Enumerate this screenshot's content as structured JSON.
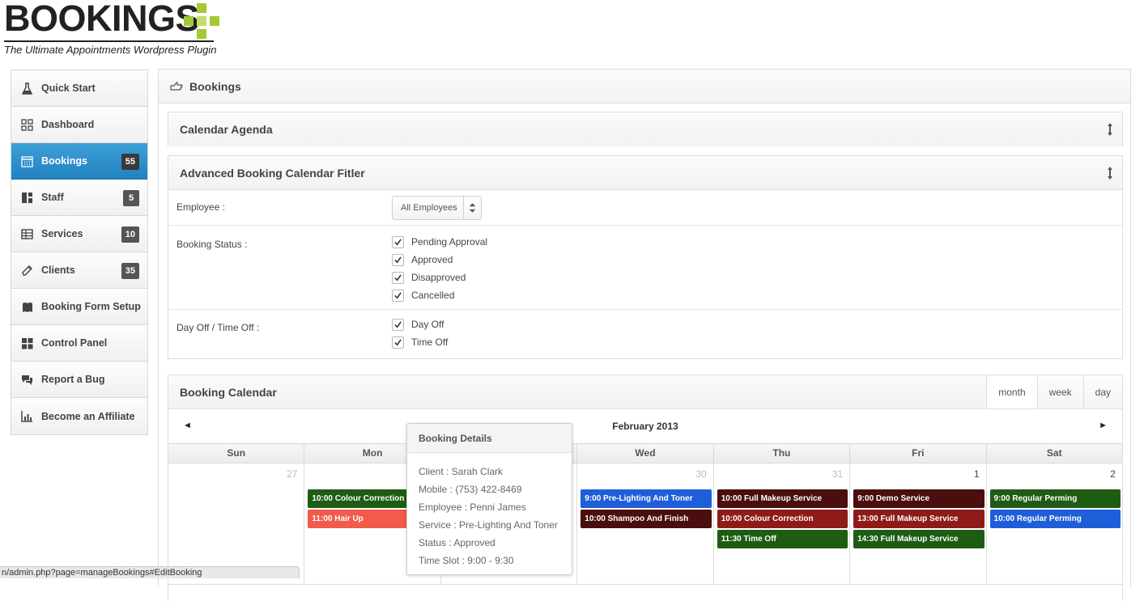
{
  "logo": {
    "word": "BOOKINGS",
    "tagline": "The Ultimate Appointments Wordpress Plugin"
  },
  "sidebar": {
    "items": [
      {
        "label": "Quick Start",
        "icon": "flask-icon",
        "badge": null,
        "active": false
      },
      {
        "label": "Dashboard",
        "icon": "grid-icon",
        "badge": null,
        "active": false
      },
      {
        "label": "Bookings",
        "icon": "calendar-icon",
        "badge": "55",
        "active": true
      },
      {
        "label": "Staff",
        "icon": "layout-icon",
        "badge": "5",
        "active": false
      },
      {
        "label": "Services",
        "icon": "table-icon",
        "badge": "10",
        "active": false
      },
      {
        "label": "Clients",
        "icon": "pencil-icon",
        "badge": "35",
        "active": false
      },
      {
        "label": "Booking Form Setup",
        "icon": "book-icon",
        "badge": null,
        "active": false
      },
      {
        "label": "Control Panel",
        "icon": "tiles-icon",
        "badge": null,
        "active": false
      },
      {
        "label": "Report a Bug",
        "icon": "chat-icon",
        "badge": null,
        "active": false
      },
      {
        "label": "Become an Affiliate",
        "icon": "bar-chart-icon",
        "badge": null,
        "active": false
      }
    ]
  },
  "main": {
    "title": "Bookings"
  },
  "agenda": {
    "title": "Calendar Agenda"
  },
  "filter": {
    "title": "Advanced Booking Calendar Fitler",
    "employee_label": "Employee :",
    "employee_value": "All Employees",
    "status_label": "Booking Status :",
    "status_options": [
      "Pending Approval",
      "Approved",
      "Disapproved",
      "Cancelled"
    ],
    "dayoff_label": "Day Off / Time Off :",
    "dayoff_options": [
      "Day Off",
      "Time Off"
    ]
  },
  "calendar": {
    "title": "Booking Calendar",
    "views": [
      "month",
      "week",
      "day"
    ],
    "active_view": "month",
    "month": "February 2013",
    "prev": "◄",
    "next": "►",
    "weekdays": [
      "Sun",
      "Mon",
      "Tue",
      "Wed",
      "Thu",
      "Fri",
      "Sat"
    ],
    "days": [
      {
        "num": "27",
        "other": true,
        "events": []
      },
      {
        "num": "",
        "other": true,
        "events": [
          {
            "text": "10:00 Colour Correction",
            "color": "#1d5c12"
          },
          {
            "text": "11:00 Hair Up",
            "color": "#f25a4a"
          }
        ]
      },
      {
        "num": "",
        "other": true,
        "events": []
      },
      {
        "num": "30",
        "other": true,
        "events": [
          {
            "text": "9:00 Pre-Lighting And Toner",
            "color": "#1f5ed9"
          },
          {
            "text": "10:00 Shampoo And Finish",
            "color": "#4a0e0e"
          }
        ]
      },
      {
        "num": "31",
        "other": true,
        "events": [
          {
            "text": "10:00 Full Makeup Service",
            "color": "#4a0e0e"
          },
          {
            "text": "10:00 Colour Correction",
            "color": "#8e1b17"
          },
          {
            "text": "11:30 Time Off",
            "color": "#1d5c12"
          }
        ]
      },
      {
        "num": "1",
        "other": false,
        "events": [
          {
            "text": "9:00 Demo Service",
            "color": "#4a0e0e"
          },
          {
            "text": "13:00 Full Makeup Service",
            "color": "#8e1b17"
          },
          {
            "text": "14:30 Full Makeup Service",
            "color": "#1d5c12"
          }
        ]
      },
      {
        "num": "2",
        "other": false,
        "events": [
          {
            "text": "9:00 Regular Perming",
            "color": "#1d5c12"
          },
          {
            "text": "10:00 Regular Perming",
            "color": "#1f5ed9"
          }
        ]
      }
    ]
  },
  "tooltip": {
    "title": "Booking Details",
    "lines": [
      "Client : Sarah Clark",
      "Mobile : (753) 422-8469",
      "Employee : Penni James",
      "Service : Pre-Lighting And Toner",
      "Status : Approved",
      "Time Slot : 9:00 - 9:30"
    ]
  },
  "statusbar": {
    "url": "n/admin.php?page=manageBookings#EditBooking"
  },
  "colors": {
    "accent": "#2e90cc",
    "logo_green": "#a4c935"
  }
}
